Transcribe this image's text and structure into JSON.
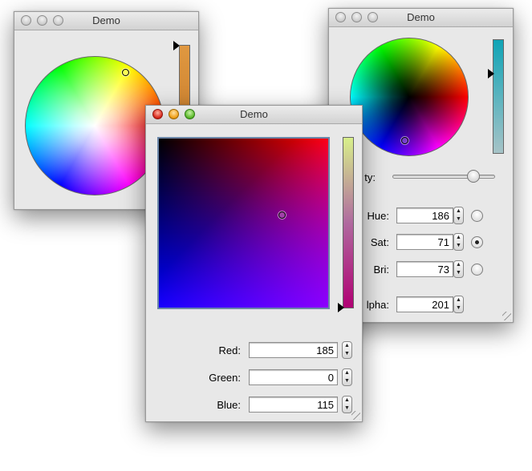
{
  "windows": {
    "left": {
      "title": "Demo"
    },
    "right": {
      "title": "Demo",
      "opacity_label": "ty:",
      "hue_label": "Hue:",
      "sat_label": "Sat:",
      "bri_label": "Bri:",
      "alpha_label": "lpha:",
      "hue_value": "186",
      "sat_value": "71",
      "bri_value": "73",
      "alpha_value": "201",
      "selected_mode": "Sat"
    },
    "front": {
      "title": "Demo",
      "red_label": "Red:",
      "green_label": "Green:",
      "blue_label": "Blue:",
      "red_value": "185",
      "green_value": "0",
      "blue_value": "115"
    }
  },
  "stepper": {
    "up": "▲",
    "down": "▼"
  },
  "colors": {
    "left_bar": "#d9862a",
    "right_bar": "#1f9aa7",
    "front_bar_top": "#d8f08a",
    "front_bar_bottom": "#b00073",
    "selection_border": "#6b87a8"
  }
}
